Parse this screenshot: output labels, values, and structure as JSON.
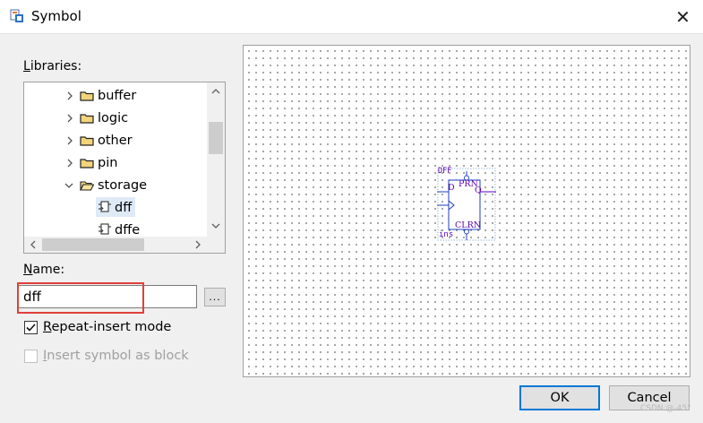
{
  "window": {
    "title": "Symbol",
    "close_glyph": "✕"
  },
  "libraries": {
    "label_underlined": "L",
    "label_rest": "ibraries:",
    "items": [
      {
        "label": "buffer",
        "expanded": false,
        "type": "folder"
      },
      {
        "label": "logic",
        "expanded": false,
        "type": "folder"
      },
      {
        "label": "other",
        "expanded": false,
        "type": "folder"
      },
      {
        "label": "pin",
        "expanded": false,
        "type": "folder"
      },
      {
        "label": "storage",
        "expanded": true,
        "type": "folder"
      },
      {
        "label": "dff",
        "type": "symbol",
        "selected": true
      },
      {
        "label": "dffe",
        "type": "symbol",
        "selected": false
      }
    ]
  },
  "name": {
    "label_underlined": "N",
    "label_rest": "ame:",
    "value": "dff",
    "browse_label": "..."
  },
  "options": {
    "repeat_insert": {
      "underlined": "R",
      "rest": "epeat-insert mode",
      "checked": true,
      "enabled": true
    },
    "insert_as_block": {
      "underlined": "I",
      "rest": "nsert symbol as block",
      "checked": false,
      "enabled": false
    }
  },
  "preview_symbol": {
    "type_label": "DFF",
    "pin_d": "D",
    "pin_q": "Q",
    "pin_prn": "PRN",
    "pin_clrn": "CLRN",
    "instance": "ins"
  },
  "buttons": {
    "ok": "OK",
    "cancel": "Cancel"
  },
  "watermark": "CSDN @-45°",
  "colors": {
    "highlight": "#e0403a",
    "ok_border": "#0078d7",
    "symbol_pin_text": "#5b00b0",
    "symbol_outline": "#1d3fbf"
  }
}
